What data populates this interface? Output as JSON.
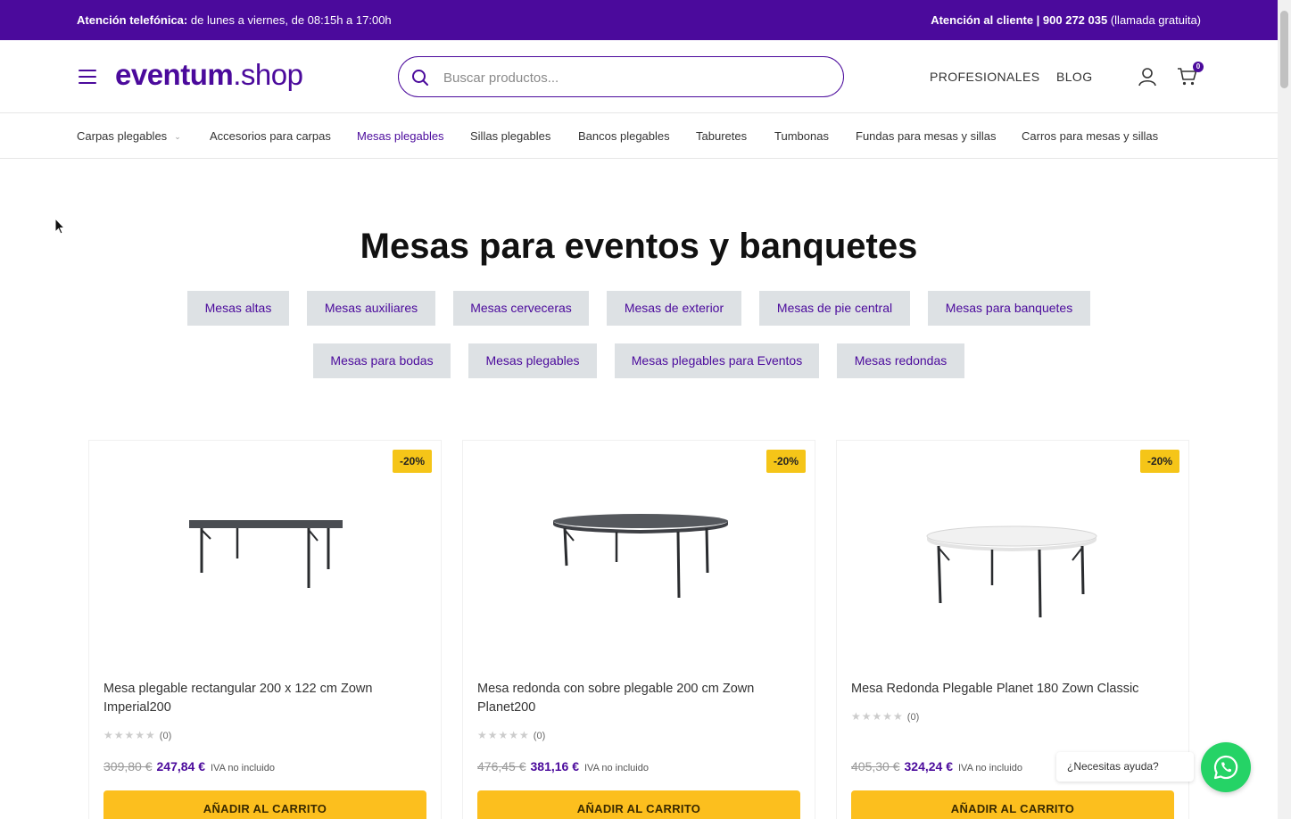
{
  "topbar": {
    "left_bold": "Atención telefónica:",
    "left_text": "de lunes a viernes, de 08:15h a 17:00h",
    "right_bold": "Atención al cliente | 900 272 035",
    "right_text": "(llamada gratuita)"
  },
  "header": {
    "logo_bold": "eventum",
    "logo_rest": ".shop",
    "search_placeholder": "Buscar productos...",
    "nav": [
      "PROFESIONALES",
      "BLOG"
    ],
    "cart_count": "0"
  },
  "categories": [
    {
      "label": "Carpas plegables",
      "has_dropdown": true
    },
    {
      "label": "Accesorios para carpas"
    },
    {
      "label": "Mesas plegables",
      "active": true
    },
    {
      "label": "Sillas plegables"
    },
    {
      "label": "Bancos plegables"
    },
    {
      "label": "Taburetes"
    },
    {
      "label": "Tumbonas"
    },
    {
      "label": "Fundas para mesas y sillas"
    },
    {
      "label": "Carros para mesas y sillas"
    }
  ],
  "page_title": "Mesas para eventos y banquetes",
  "subcategories": [
    "Mesas altas",
    "Mesas auxiliares",
    "Mesas cerveceras",
    "Mesas de exterior",
    "Mesas de pie central",
    "Mesas para banquetes",
    "Mesas para bodas",
    "Mesas plegables",
    "Mesas plegables para Eventos",
    "Mesas redondas"
  ],
  "products": [
    {
      "name": "Mesa plegable rectangular 200 x 122 cm Zown Imperial200",
      "discount": "-20%",
      "rating_count": "(0)",
      "old_price": "309,80 €",
      "price": "247,84 €",
      "vat": "IVA no incluido",
      "button": "AÑADIR AL CARRITO"
    },
    {
      "name": "Mesa redonda con sobre plegable 200 cm Zown Planet200",
      "discount": "-20%",
      "rating_count": "(0)",
      "old_price": "476,45 €",
      "price": "381,16 €",
      "vat": "IVA no incluido",
      "button": "AÑADIR AL CARRITO"
    },
    {
      "name": "Mesa Redonda Plegable Planet 180 Zown Classic",
      "discount": "-20%",
      "rating_count": "(0)",
      "old_price": "405,30 €",
      "price": "324,24 €",
      "vat": "IVA no incluido",
      "button": "AÑADIR AL CARRITO"
    }
  ],
  "help_text": "¿Necesitas ayuda?",
  "colors": {
    "brand": "#4b0a9c",
    "accent": "#fcbf1e",
    "whatsapp": "#25d366"
  }
}
